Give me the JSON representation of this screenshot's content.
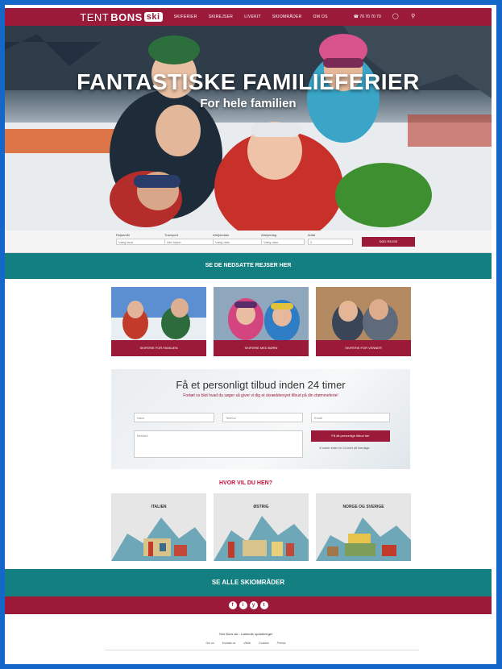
{
  "header": {
    "logo_a": "TENT",
    "logo_b": "BONS",
    "logo_ski": "ski",
    "nav": [
      "SKIFERIER",
      "SKIREJSER",
      "LIVEKIT",
      "SKIOMRÅDER",
      "OM OS"
    ],
    "phone": "☎ 70 70 70 70"
  },
  "hero": {
    "title": "FANTASTISKE FAMILIEFERIER",
    "subtitle": "For hele familien"
  },
  "search": {
    "fields": [
      {
        "label": "Rejsemål",
        "value": "Vælg land"
      },
      {
        "label": "Transport",
        "value": "Alle rejser"
      },
      {
        "label": "Afrejsedato",
        "value": "Vælg dato"
      },
      {
        "label": "Afrejsedag",
        "value": "Vælg dato"
      },
      {
        "label": "Antal",
        "value": "2"
      }
    ],
    "button": "SØG REJSE"
  },
  "band1": "SE DE NEDSATTE REJSER HER",
  "cards": [
    {
      "caption": "SKIFERIE FOR FAMILIEN"
    },
    {
      "caption": "SKIFERIE MED BØRN"
    },
    {
      "caption": "SKIFERIE FOR VENNER"
    }
  ],
  "offer": {
    "title": "Få et personligt tilbud inden 24 timer",
    "subtitle": "Fortæl os blot hvad du søger så giver vi dig et skræddersyet tilbud på din drømmeferie!",
    "name_placeholder": "Navn",
    "phone_placeholder": "Telefon",
    "email_placeholder": "Email",
    "message_placeholder": "Besked",
    "button": "Få dit personlige tilbud her",
    "note": "Vi svarer inden for 24 timer på hverdage"
  },
  "destinations": {
    "heading": "HVOR VIL DU HEN?",
    "items": [
      "ITALIEN",
      "ØSTRIG",
      "NORGE OG SVERIGE"
    ]
  },
  "band2": "SE ALLE SKIOMRÅDER",
  "social": [
    "f",
    "i",
    "y",
    "t"
  ],
  "footer": {
    "title": "Tent Bons ski - Løbende opdateringer",
    "links": [
      "Om os",
      "Kontakt os",
      "Vilkår",
      "Cookies",
      "Presse"
    ]
  },
  "colors": {
    "brand": "#9b1a3a",
    "teal": "#137f80",
    "accent_red": "#c4123a"
  }
}
